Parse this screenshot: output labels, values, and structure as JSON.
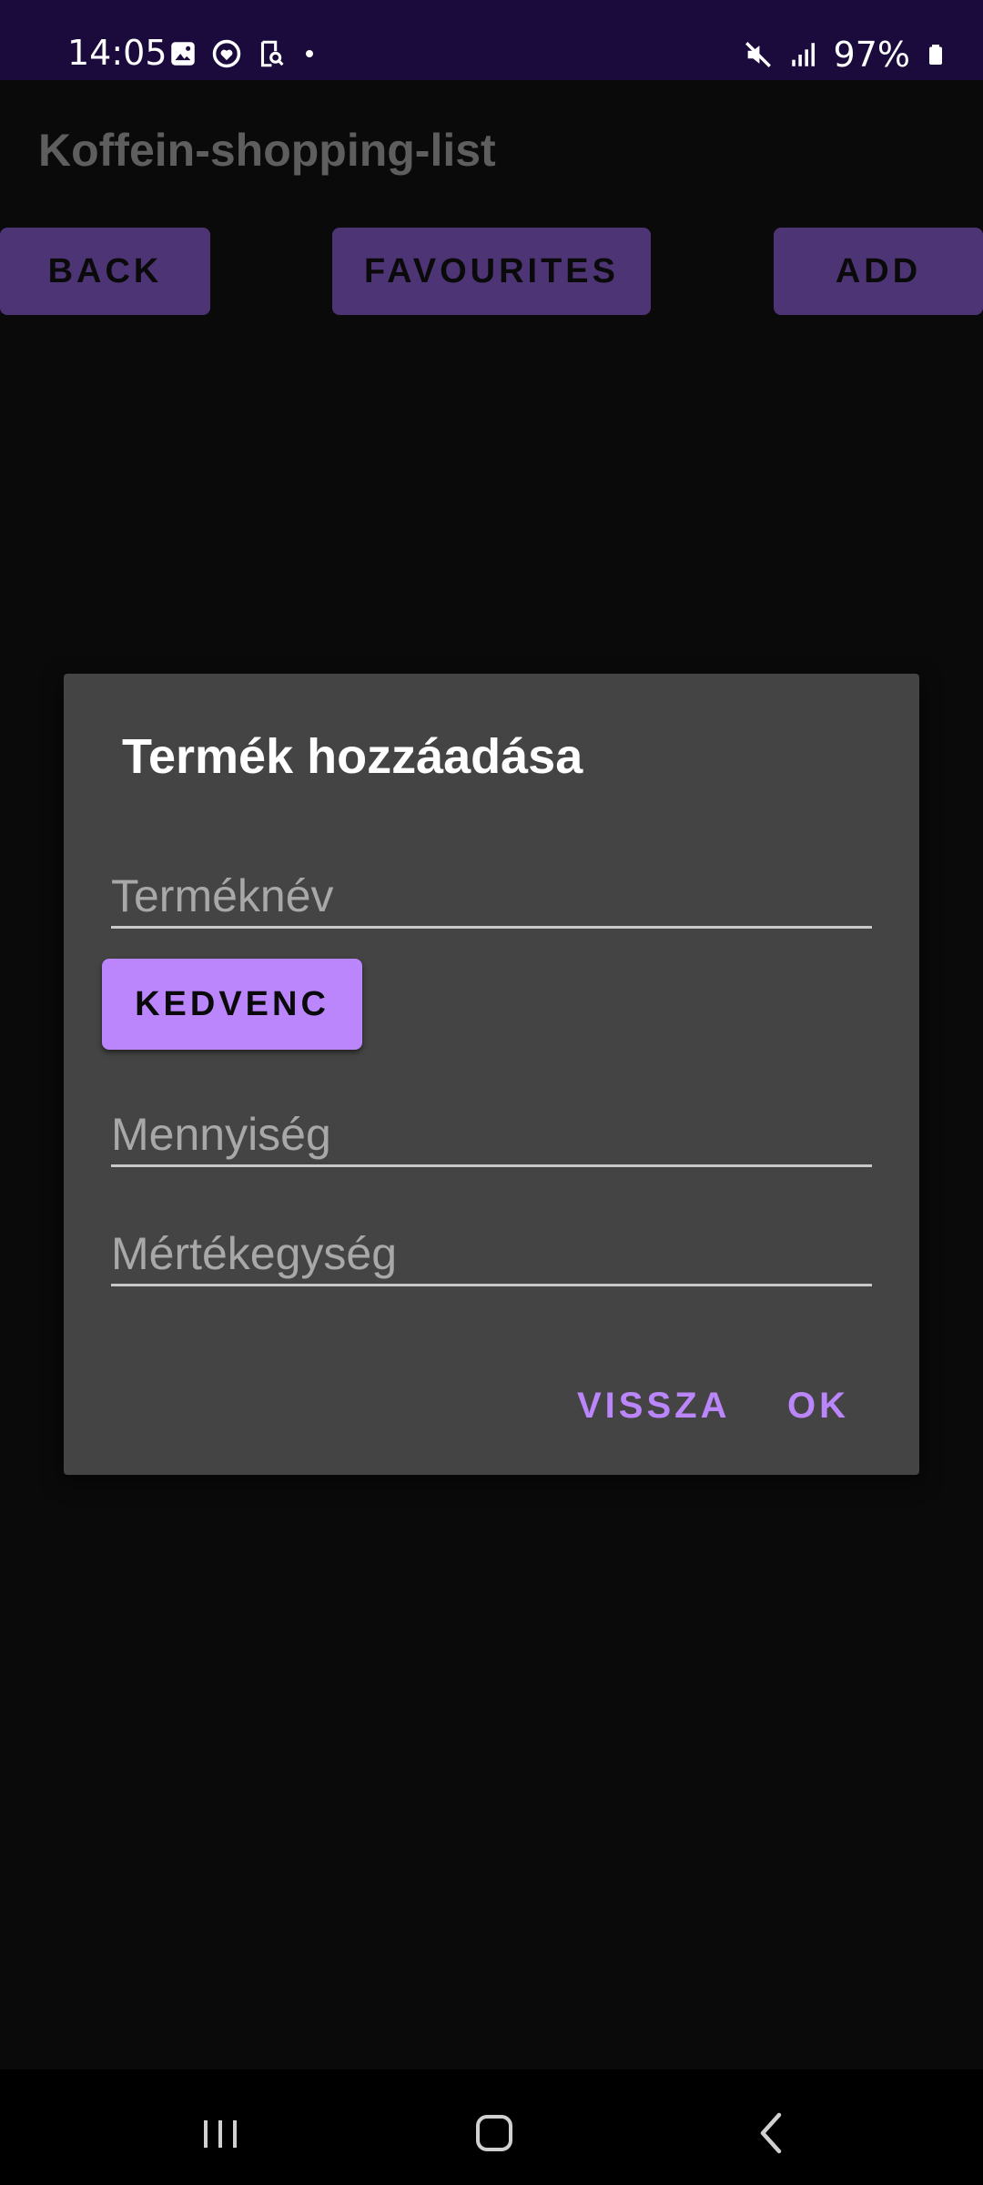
{
  "status_bar": {
    "time": "14:05",
    "battery": "97%",
    "icons_left": [
      "gallery-icon",
      "heart-circle-icon",
      "screen-search-icon",
      "dot-icon"
    ],
    "icons_right": [
      "mute-icon",
      "signal-icon",
      "battery-icon"
    ]
  },
  "app_bar": {
    "title": "Koffein-shopping-list"
  },
  "toolbar": {
    "back_label": "BACK",
    "favourites_label": "FAVOURITES",
    "add_label": "ADD",
    "button_color": "#4d3575"
  },
  "dialog": {
    "title": "Termék hozzáadása",
    "name_placeholder": "Terméknév",
    "name_value": "",
    "favourite_label": "KEDVENC",
    "quantity_placeholder": "Mennyiség",
    "quantity_value": "",
    "unit_placeholder": "Mértékegység",
    "unit_value": "",
    "cancel_label": "VISSZA",
    "ok_label": "OK",
    "accent_color": "#bb86fc",
    "background_color": "#444444"
  },
  "nav_bar": {
    "items": [
      "recents-icon",
      "home-icon",
      "back-icon"
    ]
  }
}
